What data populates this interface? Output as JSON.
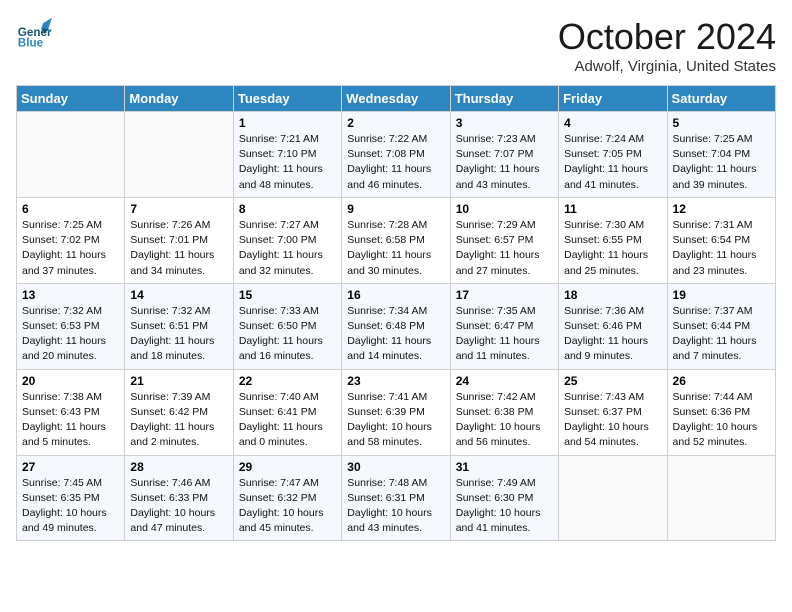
{
  "header": {
    "logo_line1": "General",
    "logo_line2": "Blue",
    "month": "October 2024",
    "location": "Adwolf, Virginia, United States"
  },
  "weekdays": [
    "Sunday",
    "Monday",
    "Tuesday",
    "Wednesday",
    "Thursday",
    "Friday",
    "Saturday"
  ],
  "weeks": [
    [
      {
        "day": "",
        "sunrise": "",
        "sunset": "",
        "daylight": ""
      },
      {
        "day": "",
        "sunrise": "",
        "sunset": "",
        "daylight": ""
      },
      {
        "day": "1",
        "sunrise": "Sunrise: 7:21 AM",
        "sunset": "Sunset: 7:10 PM",
        "daylight": "Daylight: 11 hours and 48 minutes."
      },
      {
        "day": "2",
        "sunrise": "Sunrise: 7:22 AM",
        "sunset": "Sunset: 7:08 PM",
        "daylight": "Daylight: 11 hours and 46 minutes."
      },
      {
        "day": "3",
        "sunrise": "Sunrise: 7:23 AM",
        "sunset": "Sunset: 7:07 PM",
        "daylight": "Daylight: 11 hours and 43 minutes."
      },
      {
        "day": "4",
        "sunrise": "Sunrise: 7:24 AM",
        "sunset": "Sunset: 7:05 PM",
        "daylight": "Daylight: 11 hours and 41 minutes."
      },
      {
        "day": "5",
        "sunrise": "Sunrise: 7:25 AM",
        "sunset": "Sunset: 7:04 PM",
        "daylight": "Daylight: 11 hours and 39 minutes."
      }
    ],
    [
      {
        "day": "6",
        "sunrise": "Sunrise: 7:25 AM",
        "sunset": "Sunset: 7:02 PM",
        "daylight": "Daylight: 11 hours and 37 minutes."
      },
      {
        "day": "7",
        "sunrise": "Sunrise: 7:26 AM",
        "sunset": "Sunset: 7:01 PM",
        "daylight": "Daylight: 11 hours and 34 minutes."
      },
      {
        "day": "8",
        "sunrise": "Sunrise: 7:27 AM",
        "sunset": "Sunset: 7:00 PM",
        "daylight": "Daylight: 11 hours and 32 minutes."
      },
      {
        "day": "9",
        "sunrise": "Sunrise: 7:28 AM",
        "sunset": "Sunset: 6:58 PM",
        "daylight": "Daylight: 11 hours and 30 minutes."
      },
      {
        "day": "10",
        "sunrise": "Sunrise: 7:29 AM",
        "sunset": "Sunset: 6:57 PM",
        "daylight": "Daylight: 11 hours and 27 minutes."
      },
      {
        "day": "11",
        "sunrise": "Sunrise: 7:30 AM",
        "sunset": "Sunset: 6:55 PM",
        "daylight": "Daylight: 11 hours and 25 minutes."
      },
      {
        "day": "12",
        "sunrise": "Sunrise: 7:31 AM",
        "sunset": "Sunset: 6:54 PM",
        "daylight": "Daylight: 11 hours and 23 minutes."
      }
    ],
    [
      {
        "day": "13",
        "sunrise": "Sunrise: 7:32 AM",
        "sunset": "Sunset: 6:53 PM",
        "daylight": "Daylight: 11 hours and 20 minutes."
      },
      {
        "day": "14",
        "sunrise": "Sunrise: 7:32 AM",
        "sunset": "Sunset: 6:51 PM",
        "daylight": "Daylight: 11 hours and 18 minutes."
      },
      {
        "day": "15",
        "sunrise": "Sunrise: 7:33 AM",
        "sunset": "Sunset: 6:50 PM",
        "daylight": "Daylight: 11 hours and 16 minutes."
      },
      {
        "day": "16",
        "sunrise": "Sunrise: 7:34 AM",
        "sunset": "Sunset: 6:48 PM",
        "daylight": "Daylight: 11 hours and 14 minutes."
      },
      {
        "day": "17",
        "sunrise": "Sunrise: 7:35 AM",
        "sunset": "Sunset: 6:47 PM",
        "daylight": "Daylight: 11 hours and 11 minutes."
      },
      {
        "day": "18",
        "sunrise": "Sunrise: 7:36 AM",
        "sunset": "Sunset: 6:46 PM",
        "daylight": "Daylight: 11 hours and 9 minutes."
      },
      {
        "day": "19",
        "sunrise": "Sunrise: 7:37 AM",
        "sunset": "Sunset: 6:44 PM",
        "daylight": "Daylight: 11 hours and 7 minutes."
      }
    ],
    [
      {
        "day": "20",
        "sunrise": "Sunrise: 7:38 AM",
        "sunset": "Sunset: 6:43 PM",
        "daylight": "Daylight: 11 hours and 5 minutes."
      },
      {
        "day": "21",
        "sunrise": "Sunrise: 7:39 AM",
        "sunset": "Sunset: 6:42 PM",
        "daylight": "Daylight: 11 hours and 2 minutes."
      },
      {
        "day": "22",
        "sunrise": "Sunrise: 7:40 AM",
        "sunset": "Sunset: 6:41 PM",
        "daylight": "Daylight: 11 hours and 0 minutes."
      },
      {
        "day": "23",
        "sunrise": "Sunrise: 7:41 AM",
        "sunset": "Sunset: 6:39 PM",
        "daylight": "Daylight: 10 hours and 58 minutes."
      },
      {
        "day": "24",
        "sunrise": "Sunrise: 7:42 AM",
        "sunset": "Sunset: 6:38 PM",
        "daylight": "Daylight: 10 hours and 56 minutes."
      },
      {
        "day": "25",
        "sunrise": "Sunrise: 7:43 AM",
        "sunset": "Sunset: 6:37 PM",
        "daylight": "Daylight: 10 hours and 54 minutes."
      },
      {
        "day": "26",
        "sunrise": "Sunrise: 7:44 AM",
        "sunset": "Sunset: 6:36 PM",
        "daylight": "Daylight: 10 hours and 52 minutes."
      }
    ],
    [
      {
        "day": "27",
        "sunrise": "Sunrise: 7:45 AM",
        "sunset": "Sunset: 6:35 PM",
        "daylight": "Daylight: 10 hours and 49 minutes."
      },
      {
        "day": "28",
        "sunrise": "Sunrise: 7:46 AM",
        "sunset": "Sunset: 6:33 PM",
        "daylight": "Daylight: 10 hours and 47 minutes."
      },
      {
        "day": "29",
        "sunrise": "Sunrise: 7:47 AM",
        "sunset": "Sunset: 6:32 PM",
        "daylight": "Daylight: 10 hours and 45 minutes."
      },
      {
        "day": "30",
        "sunrise": "Sunrise: 7:48 AM",
        "sunset": "Sunset: 6:31 PM",
        "daylight": "Daylight: 10 hours and 43 minutes."
      },
      {
        "day": "31",
        "sunrise": "Sunrise: 7:49 AM",
        "sunset": "Sunset: 6:30 PM",
        "daylight": "Daylight: 10 hours and 41 minutes."
      },
      {
        "day": "",
        "sunrise": "",
        "sunset": "",
        "daylight": ""
      },
      {
        "day": "",
        "sunrise": "",
        "sunset": "",
        "daylight": ""
      }
    ]
  ]
}
